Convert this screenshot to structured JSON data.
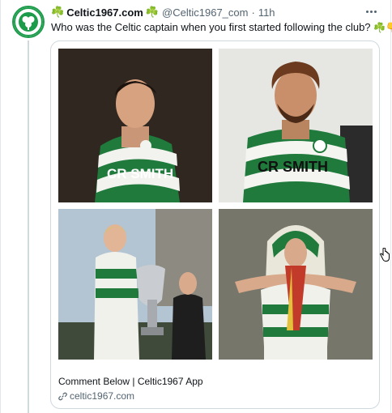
{
  "tweet": {
    "clover_left": "☘️",
    "display_name": "Celtic1967.com",
    "clover_right": "☘️",
    "handle": "@Celtic1967_com",
    "separator": "·",
    "time": "11h",
    "text": "Who was the Celtic captain when you first started following the club?",
    "text_emojis": "☘️👇"
  },
  "card": {
    "images": [
      {
        "alt": "Player in green and white hooped shirt with CR SMITH sponsor",
        "shirt_text": "CR SMITH"
      },
      {
        "alt": "Bearded player in hooped shirt with CR SMITH sponsor",
        "shirt_text": "CR SMITH"
      },
      {
        "alt": "Captain holding European Cup trophy"
      },
      {
        "alt": "Player with scarves celebrating"
      }
    ],
    "title": "Comment Below | Celtic1967 App",
    "link": "celtic1967.com"
  },
  "icons": {
    "avatar": "celtic-crest-icon",
    "more": "more-icon",
    "link": "link-icon",
    "cursor": "hand-cursor-icon"
  },
  "colors": {
    "celtic_green": "#1c9b4a",
    "text_secondary": "#536471",
    "border": "#cfd9de"
  }
}
